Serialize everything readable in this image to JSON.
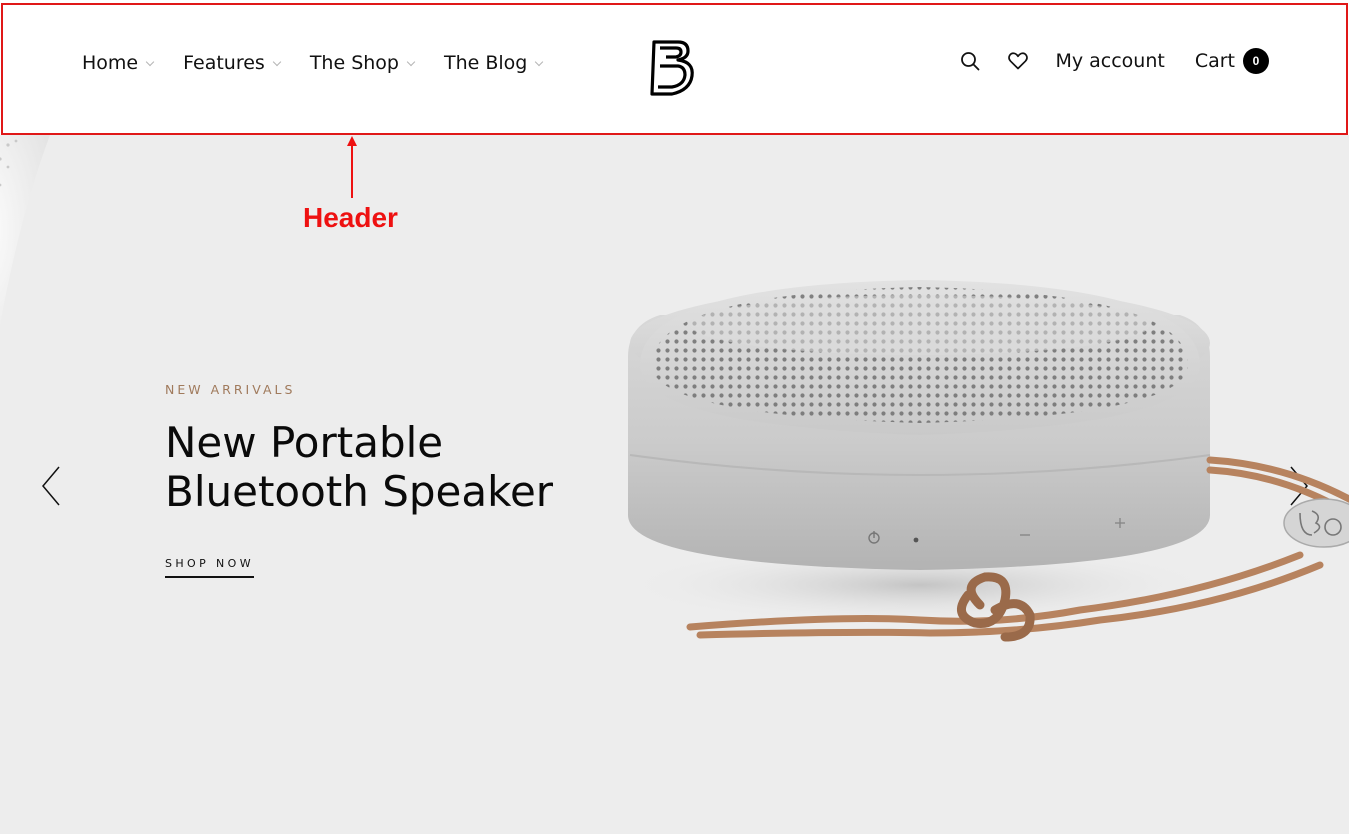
{
  "header": {
    "nav": [
      {
        "label": "Home"
      },
      {
        "label": "Features"
      },
      {
        "label": "The Shop"
      },
      {
        "label": "The Blog"
      }
    ],
    "account_label": "My account",
    "cart_label": "Cart",
    "cart_count": "0",
    "icons": [
      "search-icon",
      "heart-icon",
      "logo"
    ]
  },
  "annotation": {
    "label": "Header",
    "color": "#ee1111"
  },
  "hero": {
    "eyebrow": "NEW ARRIVALS",
    "title_line1": "New Portable",
    "title_line2": "Bluetooth Speaker",
    "cta": "SHOP NOW",
    "accent_color": "#a07a5c",
    "background": "#ededed"
  }
}
